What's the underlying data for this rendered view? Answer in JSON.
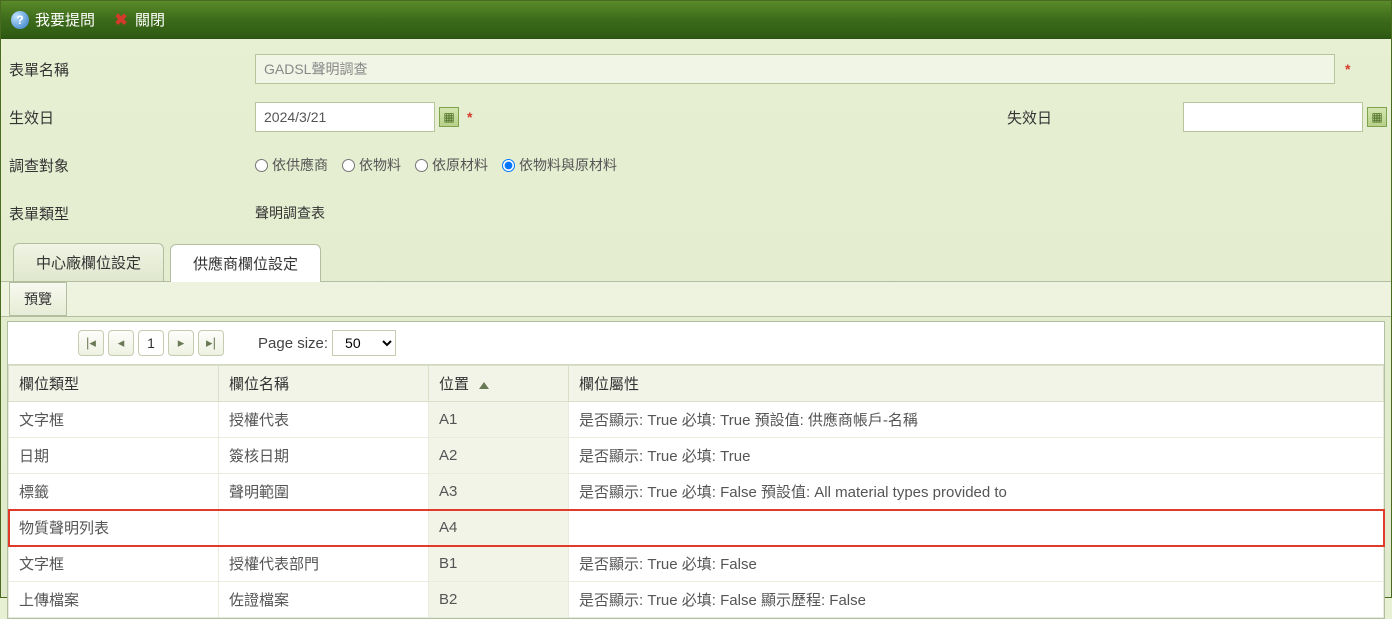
{
  "toolbar": {
    "ask_label": "我要提問",
    "close_label": "關閉"
  },
  "form": {
    "name_label": "表單名稱",
    "name_value": "GADSL聲明調查",
    "effective_label": "生效日",
    "effective_value": "2024/3/21",
    "expire_label": "失效日",
    "expire_value": "",
    "target_label": "調查對象",
    "radios": [
      {
        "label": "依供應商",
        "checked": false
      },
      {
        "label": "依物料",
        "checked": false
      },
      {
        "label": "依原材料",
        "checked": false
      },
      {
        "label": "依物料與原材料",
        "checked": true
      }
    ],
    "type_label": "表單類型",
    "type_value": "聲明調查表"
  },
  "tabs": {
    "tab1": "中心廠欄位設定",
    "tab2": "供應商欄位設定",
    "subtab1": "預覽"
  },
  "pager": {
    "page": "1",
    "size_label": "Page size:",
    "size_value": "50"
  },
  "grid": {
    "headers": {
      "type": "欄位類型",
      "name": "欄位名稱",
      "pos": "位置",
      "attr": "欄位屬性"
    },
    "rows": [
      {
        "type": "文字框",
        "name": "授權代表",
        "pos": "A1",
        "attr": "是否顯示: True 必填: True 預設值: 供應商帳戶-名稱",
        "hl": false
      },
      {
        "type": "日期",
        "name": "簽核日期",
        "pos": "A2",
        "attr": "是否顯示: True 必填: True",
        "hl": false
      },
      {
        "type": "標籤",
        "name": "聲明範圍",
        "pos": "A3",
        "attr": "是否顯示: True 必填: False 預設值: All material types provided to",
        "hl": false
      },
      {
        "type": "物質聲明列表",
        "name": "",
        "pos": "A4",
        "attr": "",
        "hl": true
      },
      {
        "type": "文字框",
        "name": "授權代表部門",
        "pos": "B1",
        "attr": "是否顯示: True 必填: False",
        "hl": false
      },
      {
        "type": "上傳檔案",
        "name": "佐證檔案",
        "pos": "B2",
        "attr": "是否顯示: True 必填: False 顯示歷程: False",
        "hl": false
      }
    ]
  }
}
